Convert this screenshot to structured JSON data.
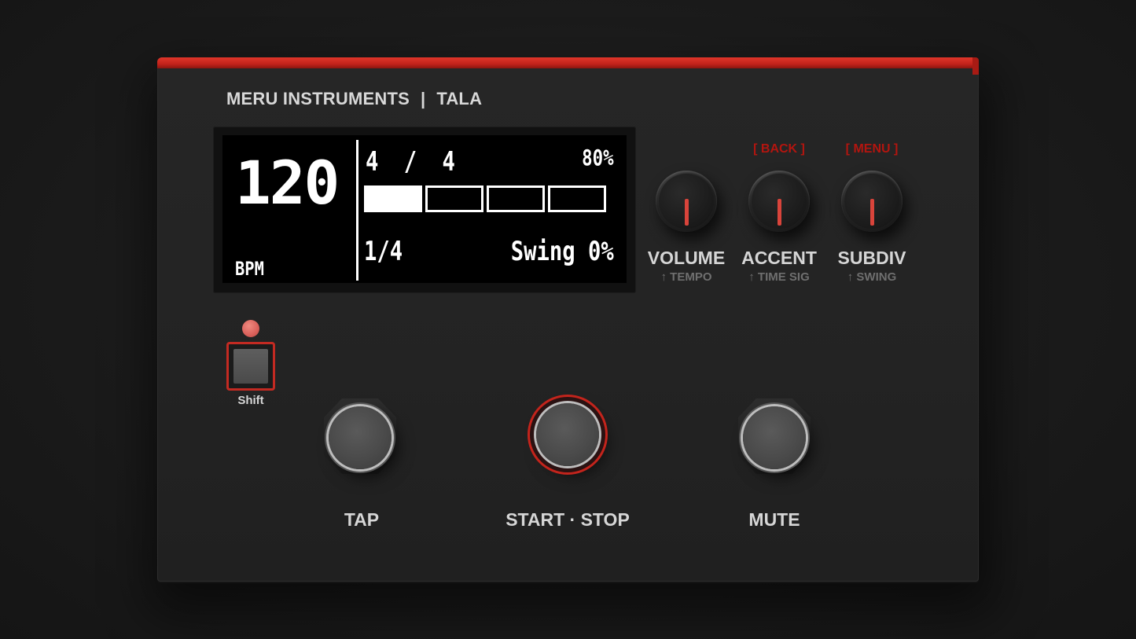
{
  "brand": {
    "maker": "MERU INSTRUMENTS",
    "separator": "|",
    "model": "TALA"
  },
  "screen": {
    "bpm": "120",
    "bpm_label": "BPM",
    "time_signature": "4 / 4",
    "volume_percent": "80%",
    "beats_total": 4,
    "beat_active": 1,
    "subdivision": "1/4",
    "swing": "Swing 0%"
  },
  "knobs": [
    {
      "top_label": "",
      "label": "VOLUME",
      "sub_label": "↑ TEMPO"
    },
    {
      "top_label": "[ BACK ]",
      "label": "ACCENT",
      "sub_label": "↑ TIME SIG"
    },
    {
      "top_label": "[ MENU ]",
      "label": "SUBDIV",
      "sub_label": "↑ SWING"
    }
  ],
  "shift": {
    "label": "Shift"
  },
  "footswitches": [
    {
      "label": "TAP"
    },
    {
      "label": "START · STOP"
    },
    {
      "label": "MUTE"
    }
  ],
  "colors": {
    "accent": "#c3241c",
    "panel": "#232323",
    "label": "#d6d6d6",
    "sub_label": "#6f6f6f"
  }
}
